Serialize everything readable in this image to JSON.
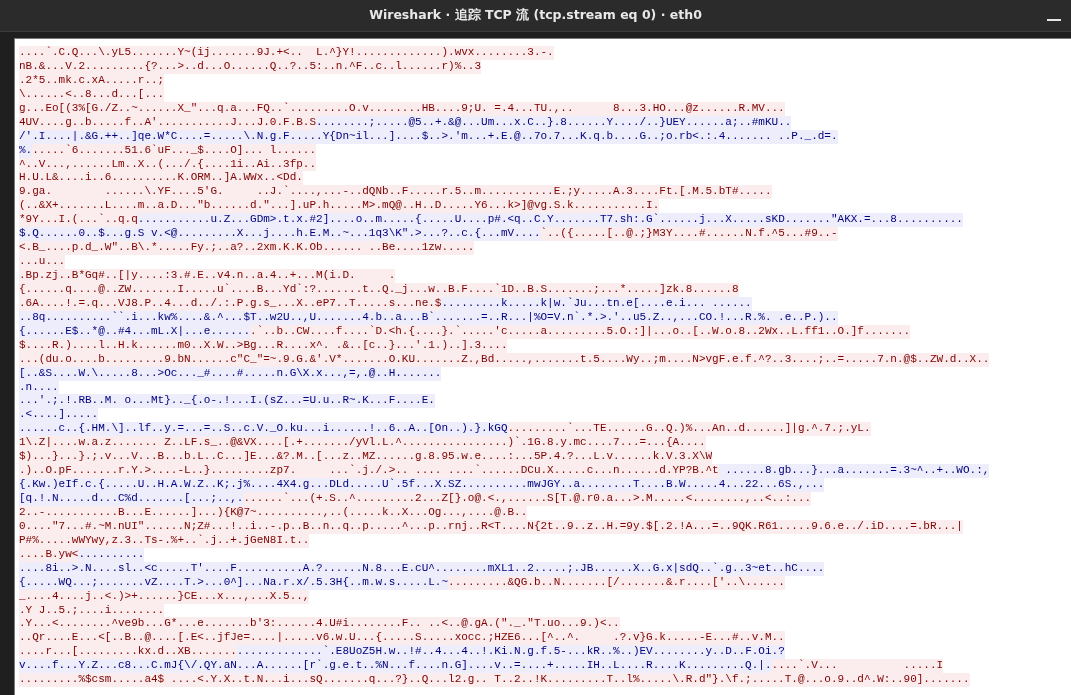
{
  "window": {
    "title": "Wireshark · 追踪 TCP 流 (tcp.stream eq 0) · eth0"
  },
  "stream": [
    {
      "segments": [
        {
          "kind": "client",
          "text": "....`.C.Q...\\.yL5.......Y~(ij.......9J.+<..  L.^}Y!.............).wvx........3.-."
        }
      ]
    },
    {
      "segments": [
        {
          "kind": "client",
          "text": "nB.&...V.2.........{?...>..d...O......Q..?..5:..n.^F..c..l......r)%..3"
        }
      ]
    },
    {
      "segments": [
        {
          "kind": "client",
          "text": ".2*5..mk.c.xA.....r..;"
        }
      ]
    },
    {
      "segments": [
        {
          "kind": "client",
          "text": "\\......<..8...d...[..."
        }
      ]
    },
    {
      "segments": [
        {
          "kind": "client",
          "text": "g...Eo[(3%[G./Z..~......X_\"...q.a...FQ..`.........O.v........HB....9;U. =.4...TU.,..      8...3.HO...@z......R.MV..."
        }
      ]
    },
    {
      "segments": [
        {
          "kind": "client",
          "text": "4UV....g..b.....f..A'...........J...J.0.F.B.S"
        },
        {
          "kind": "server",
          "text": "........;.....@5..+.&@...Um...x.C..}.8......Y..../..}UEY......a;..#mKU.."
        }
      ]
    },
    {
      "segments": [
        {
          "kind": "server",
          "text": "/'.I....|.&G.++..]qe.W*C....=.....\\.N.g.F.....Y{Dn~il...]....$..>.'m...+.E.@..7o.7...K.q.b....G..;o.rb<.:.4....... ..P._.d=."
        }
      ]
    },
    {
      "segments": [
        {
          "kind": "server",
          "text": "%."
        },
        {
          "kind": "client",
          "text": ".....`6.......51.6`uF..._$....O]... l......"
        }
      ]
    },
    {
      "segments": [
        {
          "kind": "client",
          "text": "^..V...,......Lm..X..(.../.{....1i..Ai..3fp.."
        }
      ]
    },
    {
      "segments": [
        {
          "kind": "client",
          "text": "H.U.L&....i..6..........K.ORM..]A.WWx..<Dd."
        }
      ]
    },
    {
      "segments": [
        {
          "kind": "client",
          "text": "9.ga.        ......\\.YF....5'G.     ..J.`....,...-..dQNb..F.....r.5..m...........E.;y.....A.3....Ft.[.M.5.bT#....."
        }
      ]
    },
    {
      "segments": [
        {
          "kind": "client",
          "text": "(..&X+.......L....m..a.D...\"b......d.\"...].uP.h.....M>.mQ@..H..D.....Y6...k>]@vg.S.k...........I."
        }
      ]
    },
    {
      "segments": [
        {
          "kind": "client",
          "text": "*9Y...I.(...`..q.q"
        },
        {
          "kind": "server",
          "text": "...........u.Z...GDm>.t.x.#2]....o..m.....{.....U....p#.<q..C.Y.......T7.sh:.G`......j...X.....sKD.......\"AKX.=...8.........."
        }
      ]
    },
    {
      "segments": [
        {
          "kind": "server",
          "text": "$.Q......0..$...g.S v.<@.........X...j....h.E.M..~...1q3\\K\".>...?..c.{...mV...."
        },
        {
          "kind": "client",
          "text": "`..({.....[..@.;}M3Y....#......N.f.^5...#9..-"
        }
      ]
    },
    {
      "segments": [
        {
          "kind": "client",
          "text": "<.B_....p.d_.W\"..B\\.*.....Fy.;..a?..2xm.K.K.Ob...... ..Be....1zw....."
        }
      ]
    },
    {
      "segments": [
        {
          "kind": "client",
          "text": "...u..."
        }
      ]
    },
    {
      "segments": [
        {
          "kind": "client",
          "text": ".Bp.zj..B*Gq#..[|y....:3.#.E..v4.n..a.4..+...M(i.D.     ."
        }
      ]
    },
    {
      "segments": [
        {
          "kind": "client",
          "text": "{......q....@..ZW.......I.....u`....B...Yd`:?.......t..Q._j...w..B.F....`1D..B.S.......;...*.....]zk.8......8"
        }
      ]
    },
    {
      "segments": [
        {
          "kind": "client",
          "text": ".6A....!.=.q...VJ8.P..4...d../.:.P.g.s_...X..eP7..T.....s...ne.$"
        },
        {
          "kind": "server",
          "text": ".........k.....k|w.`Ju...tn.e[....e.i... ......"
        }
      ]
    },
    {
      "segments": [
        {
          "kind": "server",
          "text": "..8q..........``.i...kw%....&.^...$T..w2U..,U.......4.b..a...B`.......=..R...|%O=V.n`.*.>.'..u5.Z..,...CO.!...R.%. .e..P.).."
        }
      ]
    },
    {
      "segments": [
        {
          "kind": "server",
          "text": "{......E$..*@..#4...mL.X|...e......"
        },
        {
          "kind": "client",
          "text": ".`..b..CW....f....`D.<h.{....}.`.....'c.....a.........5.O.:]|...o..[..W.o.8..2Wx..L.ff1..O.]f......."
        }
      ]
    },
    {
      "segments": [
        {
          "kind": "client",
          "text": "$....R.)....l..H.k......m0..X.W..>Bg...R....x^. .&..[c..}...'.1.)..].3...."
        }
      ]
    },
    {
      "segments": [
        {
          "kind": "client",
          "text": "...(du.o....b.........9.bN......c\"C_\"=~.9.G.&'.V*.......O.KU.......Z.,Bd.....,.......t.5....Wy..;m....N>vgF.e.f.^?..3....;..=.....7.n.@$..ZW.d..X.."
        }
      ]
    },
    {
      "segments": [
        {
          "kind": "server",
          "text": "[..&S....W.\\.....8...>Oc..._#....#.....n.G\\X.x...,=,.@..H......."
        }
      ]
    },
    {
      "segments": [
        {
          "kind": "server",
          "text": ".n...."
        }
      ]
    },
    {
      "segments": [
        {
          "kind": "server",
          "text": "...'.;.!.RB..M. o...Mt}.._{.o-.!...I.(sZ...=U.u..R~.K...F....E."
        }
      ]
    },
    {
      "segments": [
        {
          "kind": "server",
          "text": ".<....]....."
        }
      ]
    },
    {
      "segments": [
        {
          "kind": "server",
          "text": "......c..{.HM.\\]..lf..y.=...=..S..c.V._O.ku...i......!..6..A..[On..).}.kGQ"
        },
        {
          "kind": "client",
          "text": ".........`...TE......G..Q.)%...An..d......]|g.^.7.;.yL."
        }
      ]
    },
    {
      "segments": [
        {
          "kind": "client",
          "text": "1\\.Z|....w.a.z....... Z..LF.s_..@&VX....[.+......./yVl.L.^................)`.1G.8.y.mc....7...=...{A...."
        }
      ]
    },
    {
      "segments": [
        {
          "kind": "client",
          "text": "$)...}...}.;.v...V...B...b.L..C...]E...&?.M..[...z..MZ......g.8.95.w.e....:...5P.4.?...L.v......k.V.3.X\\W"
        }
      ]
    },
    {
      "segments": [
        {
          "kind": "client",
          "text": ".)..O.pF.......r.Y.>....-L..}.........zp7.     ...`.j./.>.. .... ....`......DCu.X.....c...n......d.YP?B.^t"
        },
        {
          "kind": "server",
          "text": " ......8.gb...}...a.......=.3~^..+..WO.:,"
        }
      ]
    },
    {
      "segments": [
        {
          "kind": "server",
          "text": "{.Kw.)eIf.c.{.....U..H.A.W.Z..K;.j%....4X4.g...DLd.....U`.5f...X.SZ..........mwJGY..a........T....B.W.....4...22...6S.,..."
        }
      ]
    },
    {
      "segments": [
        {
          "kind": "server",
          "text": "[q.!.N.....d...C%d.......[...;..,."
        },
        {
          "kind": "client",
          "text": "......`...(+.S..^.........2...Z[}.o@.<.,......S[T.@.r0.a...>.M.....<........,..<..:..."
        }
      ]
    },
    {
      "segments": [
        {
          "kind": "client",
          "text": "2..-...........B...E......]...){K@7~..........,..(.....k..X...Og...,....@.B.."
        }
      ]
    },
    {
      "segments": [
        {
          "kind": "client",
          "text": "0....\"7...#.~M.nUI\"......N;Z#...!..i..-.p..B..n..q..p.....^...p..rnj..R<T....N{2t..9..z..H.=9y.$[.2.!A...=..9QK.R61.....9.6.e../.iD....=.bR...|"
        }
      ]
    },
    {
      "segments": [
        {
          "kind": "client",
          "text": "P#%.....wWYwy,z.3..Ts-.%+..`.j..+.jGeN8I.t.."
        }
      ]
    },
    {
      "segments": [
        {
          "kind": "client",
          "text": "....B.yw<"
        },
        {
          "kind": "server",
          "text": ".........."
        }
      ]
    },
    {
      "segments": [
        {
          "kind": "server",
          "text": "....8i..>.N....sl..<c.....T'....F..........A.?......N.8...E.cU^........mXL1..2.....;.JB......X..G.x|sdQ..`.g..3~et..hC...."
        }
      ]
    },
    {
      "segments": [
        {
          "kind": "server",
          "text": "{.....WQ...;.......vZ....T.>...0^]...Na.r.x/.5.3H{..m.w.s.....L.~"
        },
        {
          "kind": "client",
          "text": ".........&QG.b..N.......[/.......&.r....['..\\......"
        }
      ]
    },
    {
      "segments": [
        {
          "kind": "client",
          "text": "_....4....j..<.)>+......}CE...x...,...X.5..,"
        }
      ]
    },
    {
      "segments": [
        {
          "kind": "client",
          "text": ".Y J..5.;....i........"
        }
      ]
    },
    {
      "segments": [
        {
          "kind": "client",
          "text": ".Y...<........^ve9b...G*...e.......b'3:......4.U#i........F.. ..<..@.gA.(\"._.\"T.uo...9.)<.."
        }
      ]
    },
    {
      "segments": [
        {
          "kind": "client",
          "text": "..Qr....E...<[..B..@....[.E<..jfJe=....|.....v6.w.U...{.....S.....xocc.;HZE6...[^..^.     .?.v}G.k.....-E...#..v.M.."
        }
      ]
    },
    {
      "segments": [
        {
          "kind": "client",
          "text": "....r...[.........kx.d..XB......."
        },
        {
          "kind": "server",
          "text": ".............`.E8UoZ5H.w..!#..4...4..!.Ki.N.g.f.5-...kR..%..)EV........y..D..F.Oi.?"
        }
      ]
    },
    {
      "segments": [
        {
          "kind": "server",
          "text": "v....f...Y.Z...c8...C.mJ{\\/.QY.aN...A......[r`.g.e.t..%N...f....n.G]....v..=....+.....IH..L....R....K.........Q.|."
        },
        {
          "kind": "client",
          "text": "....`.V...          .....I"
        }
      ]
    },
    {
      "segments": [
        {
          "kind": "client",
          "text": ".........%$csm.....a4$ ....<.Y.X..t.N...i...sQ.......q...?}..Q...l2.g.. T..2..!K.........T..l%.....\\.R.d\"}.\\f.;.....T.@...o.9..d^.W:..90]......."
        }
      ]
    }
  ]
}
